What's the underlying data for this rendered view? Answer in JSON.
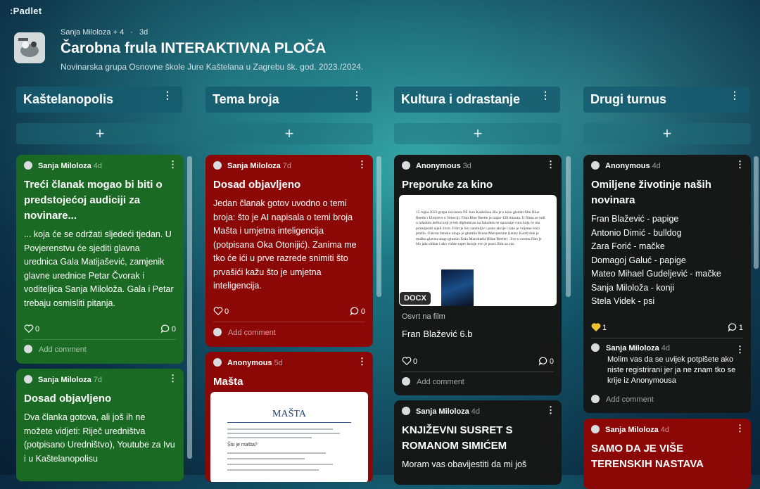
{
  "app": {
    "logo": ":Padlet"
  },
  "board": {
    "meta_author": "Sanja Miloloza + 4",
    "meta_sep": "·",
    "meta_time": "3d",
    "title": "Čarobna frula INTERAKTIVNA PLOČA",
    "subtitle": "Novinarska grupa Osnovne škole Jure Kaštelana u Zagrebu šk. god. 2023./2024."
  },
  "columns": [
    {
      "name": "Kaštelanopolis",
      "menu": "⋮",
      "add": "+"
    },
    {
      "name": "Tema broja",
      "menu": "⋮",
      "add": "+"
    },
    {
      "name": "Kultura i odrastanje",
      "menu": "⋮",
      "add": "+"
    },
    {
      "name": "Drugi turnus",
      "menu": "⋮",
      "add": "+"
    }
  ],
  "cards": {
    "c1": {
      "author": "Sanja Miloloza",
      "time": "4d",
      "title": "Treći članak mogao bi biti o predstojećoj audiciji za novinare...",
      "body": "... koja će se održati sljedeći tjedan. U Povjerenstvu će sjediti glavna urednica Gala Matijašević, zamjenik glavne urednice Petar Čvorak i voditeljica Sanja Miloloža. Gala i Petar trebaju osmisliti pitanja.",
      "likes": "0",
      "comments": "0",
      "add_comment": "Add comment",
      "color": "#1a6a23"
    },
    "c2": {
      "author": "Sanja Miloloza",
      "time": "7d",
      "title": "Dosad objavljeno",
      "body": "Dva članka gotova, ali još ih ne možete vidjeti: Riječ uredništva (potpisano Uredništvo), Youtube za Ivu i u Kaštelanopolisu",
      "color": "#1a6a23"
    },
    "t1": {
      "author": "Sanja Miloloza",
      "time": "7d",
      "title": "Dosad objavljeno",
      "body": "Jedan članak gotov uvodno o temi broja: što je AI napisala o temi broja Mašta i umjetna inteligencija (potpisana Oka Otonijić). Zanima me tko će ići u prve razrede snimiti što prvašići kažu što je umjetna inteligencija.",
      "likes": "0",
      "comments": "0",
      "add_comment": "Add comment",
      "color": "#8c0806"
    },
    "t2": {
      "author": "Anonymous",
      "time": "5d",
      "title": "Mašta",
      "doc_heading": "MAŠTA",
      "doc_q": "Što je mašta?",
      "color": "#8c0806"
    },
    "k1": {
      "author": "Anonymous",
      "time": "3d",
      "title": "Preporuke za kino",
      "doc_text": "15 rujna 2023 grupa novinara OŠ Jure Kaštelana išla je u kino gledati film Blue Beetle i Ubojstvo u Veneciji. Film Blue Beetle je trajao 128 minuta. U filmu se radi o mladom dečku koji je tek diplomirao na fakultetu te upoznaje curu koja će mu promijeniti sijeli život. Film je bio zanimljiv i puno akcije i zato je vrijeme brzo prošlo. Glavnu žensku ulogu je glumila Bruna Marquezine (Jenny Kord) dok je mušku glavnu ulogu glumio Xolo Maridueña (Blue Beetle) . Sve u svemu film je bio jako dobar i ako volite super heroje ovo je pravi film za vas.",
      "badge": "DOCX",
      "caption": "Osvrt na film",
      "attachment": "Fran Blažević 6.b",
      "likes": "0",
      "comments": "0",
      "add_comment": "Add comment",
      "color": "#161717"
    },
    "k2": {
      "author": "Sanja Miloloza",
      "time": "4d",
      "title": "KNJIŽEVNI SUSRET S ROMANOM SIMIĆEM",
      "body": "Moram vas obavijestiti da mi još",
      "color": "#161717"
    },
    "d1": {
      "author": "Anonymous",
      "time": "4d",
      "title": "Omiljene životinje naših novinara",
      "lines": [
        "Fran Blažević - papige",
        "Antonio Dimić - bulldog",
        "Zara Forić - mačke",
        "Domagoj Galuć - papige",
        "Mateo Mihael Gudeljević - mačke",
        "Sanja Miloloža - konji",
        "Stela Videk - psi"
      ],
      "likes": "1",
      "comments": "1",
      "comment_author": "Sanja Miloloza",
      "comment_time": "4d",
      "comment_text": "Molim vas da se uvijek potpišete ako niste registrirani jer ja ne znam tko se krije iz Anonymousa",
      "add_comment": "Add comment",
      "color": "#161717",
      "heart_color": "#f1c232"
    },
    "d2": {
      "author": "Sanja Miloloza",
      "time": "4d",
      "title": "SAMO DA JE VIŠE TERENSKIH NASTAVA",
      "color": "#8c0806"
    }
  }
}
